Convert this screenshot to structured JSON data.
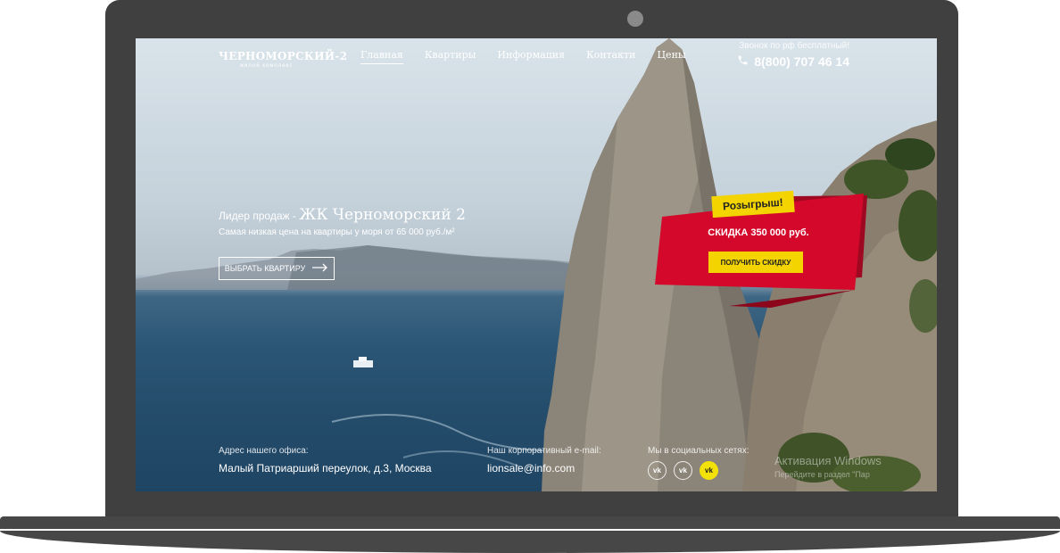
{
  "site": {
    "logo_title": "ЧЕРНОМОРСКИЙ-2",
    "logo_subtitle": "жилой комплекс",
    "nav": [
      {
        "label": "Главная",
        "active": true
      },
      {
        "label": "Квартиры"
      },
      {
        "label": "Информация"
      },
      {
        "label": "Контакти"
      },
      {
        "label": "Цены"
      }
    ],
    "phone_note": "Звонок по рф бесплатный!",
    "phone_number": "8(800) 707 46 14"
  },
  "hero": {
    "title_prefix": "Лидер продаж - ",
    "title_main": "ЖК Черноморский 2",
    "subtitle": "Самая низкая цена на квартиры у моря от 65 000 руб./м²",
    "button_label": "ВЫБРАТЬ КВАРТИРУ"
  },
  "promo": {
    "tag": "Розыгрыш!",
    "text": "СКИДКА 350 000 руб.",
    "button_label": "ПОЛУЧИТЬ СКИДКУ"
  },
  "footer": {
    "office_label": "Адрес нашего офиса:",
    "office_value": "Малый Патриарший переулок, д.3, Москва",
    "email_label": "Наш корпоративный e-mail:",
    "email_value": "lionsale@info.com",
    "social_label": "Мы в социальных сетях:",
    "socials": [
      {
        "label": "vk"
      },
      {
        "label": "vk"
      },
      {
        "label": "vk"
      }
    ]
  },
  "watermark": {
    "line1": "Активация Windows",
    "line2": "Перейдите в раздел \"Пар"
  },
  "colors": {
    "laptop_frame": "#404040",
    "promo_red": "#d4082a",
    "promo_yellow": "#f3d400",
    "sea": "#2c5676"
  },
  "icons": [
    "phone-icon",
    "arrow-right-icon",
    "vk-icon",
    "camera-dot"
  ]
}
